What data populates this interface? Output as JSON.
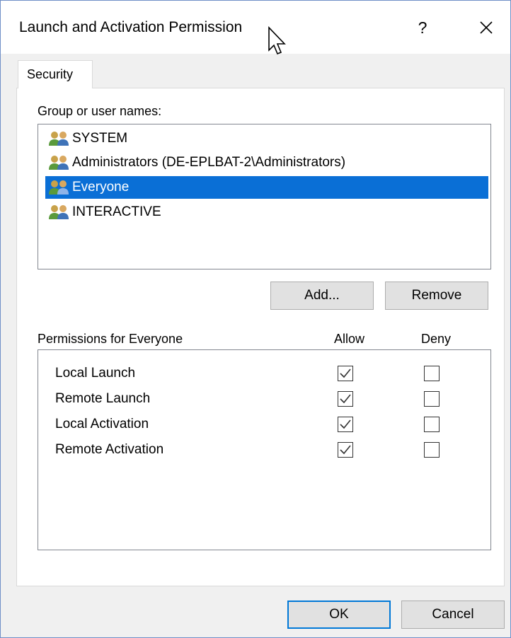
{
  "window": {
    "title": "Launch and Activation Permission",
    "help_label": "?"
  },
  "tabs": [
    {
      "label": "Security"
    }
  ],
  "groups": {
    "label": "Group or user names:",
    "items": [
      {
        "name": "SYSTEM",
        "selected": false
      },
      {
        "name": "Administrators (DE-EPLBAT-2\\Administrators)",
        "selected": false
      },
      {
        "name": "Everyone",
        "selected": true
      },
      {
        "name": "INTERACTIVE",
        "selected": false
      }
    ],
    "add_label": "Add...",
    "remove_label": "Remove"
  },
  "permissions": {
    "label": "Permissions for Everyone",
    "allow_header": "Allow",
    "deny_header": "Deny",
    "rows": [
      {
        "name": "Local Launch",
        "allow": true,
        "deny": false
      },
      {
        "name": "Remote Launch",
        "allow": true,
        "deny": false
      },
      {
        "name": "Local Activation",
        "allow": true,
        "deny": false
      },
      {
        "name": "Remote Activation",
        "allow": true,
        "deny": false
      }
    ]
  },
  "footer": {
    "ok_label": "OK",
    "cancel_label": "Cancel"
  },
  "colors": {
    "selection": "#0a6fd6",
    "default_button_border": "#0078d7"
  }
}
